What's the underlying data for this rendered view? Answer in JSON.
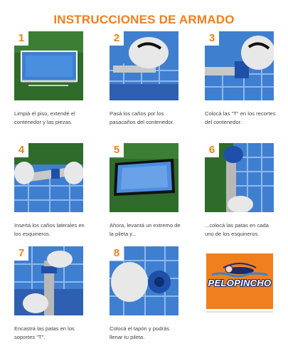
{
  "title": "INSTRUCCIONES DE ARMADO",
  "steps": [
    {
      "number": "1",
      "caption": "Limpiá el piso, extendé el contenedor y las piezas."
    },
    {
      "number": "2",
      "caption": "Pasá los caños por los pasacaños del contenedor."
    },
    {
      "number": "3",
      "caption": "Colocá las \"T\" en los recortes del contenedor."
    },
    {
      "number": "4",
      "caption": "Insertá los caños laterales en los esquineros."
    },
    {
      "number": "5",
      "caption": "Ahora, levantá un extremo de la pileta y..."
    },
    {
      "number": "6",
      "caption": "...colocá las patas en cada uno de los esquineros."
    },
    {
      "number": "7",
      "caption": "Encastrá las patas en los soportes \"T\"."
    },
    {
      "number": "8",
      "caption": "Colocá el tapón y podrás llenar tu pileta."
    }
  ],
  "brand": {
    "logo_text": "PELOPINCHO"
  },
  "colors": {
    "accent": "#f07f1e",
    "pool_blue": "#3c78c8",
    "grass": "#2f6b2a",
    "text": "#444444"
  }
}
